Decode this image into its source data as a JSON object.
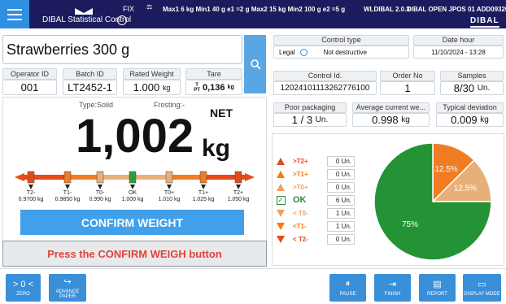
{
  "header": {
    "app_name": "DIBAL Statistical Control",
    "fix_label": "FIX",
    "scale_info": "Max1 6 kg Min1 40 g e1 =2 g Max2 15 kg Min2 100 g e2 =5 g",
    "version": "WLDIBAL 2.0.3",
    "device": "DIBAL OPEN JPOS 01 ADD09326",
    "logo": "DIBAL"
  },
  "product": {
    "name": "Strawberries 300 g"
  },
  "fields": {
    "operator_label": "Operator ID",
    "operator_value": "001",
    "batch_label": "Batch ID",
    "batch_value": "LT2452-1",
    "rated_label": "Rated Weight",
    "rated_value": "1.000",
    "rated_unit": "kg",
    "tare_label": "Tare",
    "tare_value": "0,136",
    "tare_unit": "kg",
    "tare_prefix_t": "T",
    "tare_prefix_pt": "PT"
  },
  "weight": {
    "type_text": "Type:Solid",
    "frosting_text": "Frosting:-",
    "net_label": "NET",
    "value": "1,002",
    "unit": "kg"
  },
  "scale": [
    {
      "name": "T2-",
      "value": "0.9700 kg"
    },
    {
      "name": "T1-",
      "value": "0.9850 kg"
    },
    {
      "name": "T0-",
      "value": "0.990 kg"
    },
    {
      "name": "OK",
      "value": "1.000 kg"
    },
    {
      "name": "T0+",
      "value": "1.010 kg"
    },
    {
      "name": "T1+",
      "value": "1.025 kg"
    },
    {
      "name": "T2+",
      "value": "1.050 kg"
    }
  ],
  "buttons": {
    "confirm": "CONFIRM WEIGHT"
  },
  "message": "Press the CONFIRM WEIGH button",
  "right": {
    "control_type_label": "Control type",
    "control_type_left": "Legal",
    "control_type_value": "Not destructive",
    "date_label": "Date hour",
    "date_value": "11/10/2024 - 13:28",
    "control_id_label": "Control Id.",
    "control_id_value": "12024101113262776100",
    "order_label": "Order No",
    "order_value": "1",
    "samples_label": "Samples",
    "samples_value": "8/30",
    "samples_unit": "Un.",
    "poor_label": "Poor packaging",
    "poor_value": "1 / 3",
    "poor_unit": "Un.",
    "avg_label": "Average current we...",
    "avg_value": "0.998",
    "avg_unit": "kg",
    "dev_label": "Typical deviation",
    "dev_value": "0.009",
    "dev_unit": "kg"
  },
  "stats_table": [
    {
      "label": ">T2+",
      "count": "0",
      "unit": "Un.",
      "color": "#e64a19",
      "mark": "up"
    },
    {
      "label": ">T1+",
      "count": "0",
      "unit": "Un.",
      "color": "#f57c00",
      "mark": "up"
    },
    {
      "label": ">T0+",
      "count": "0",
      "unit": "Un.",
      "color": "#f0a060",
      "mark": "up"
    },
    {
      "label": "OK",
      "count": "6",
      "unit": "Un.",
      "color": "#2e8b3a",
      "mark": "check"
    },
    {
      "label": "< T0-",
      "count": "1",
      "unit": "Un.",
      "color": "#f0a060",
      "mark": "down"
    },
    {
      "label": "<T1-",
      "count": "1",
      "unit": "Un.",
      "color": "#f57c00",
      "mark": "down"
    },
    {
      "label": "< T2-",
      "count": "0",
      "unit": "Un.",
      "color": "#e64a19",
      "mark": "down"
    }
  ],
  "pie": {
    "slices": [
      {
        "label": "12.5%",
        "value": 12.5,
        "color": "#f07d24"
      },
      {
        "label": "12.5%",
        "value": 12.5,
        "color": "#e8b079"
      },
      {
        "label": "75%",
        "value": 75,
        "color": "#239336"
      }
    ]
  },
  "footer": {
    "zero_label": "ZERO",
    "zero_glyph": "> 0 <",
    "advance_label": "ADVANCE PAPER",
    "pause_label": "PAUSE",
    "finish_label": "FINISH",
    "report_label": "REPORT",
    "display_label": "DISPLAY MODE"
  }
}
